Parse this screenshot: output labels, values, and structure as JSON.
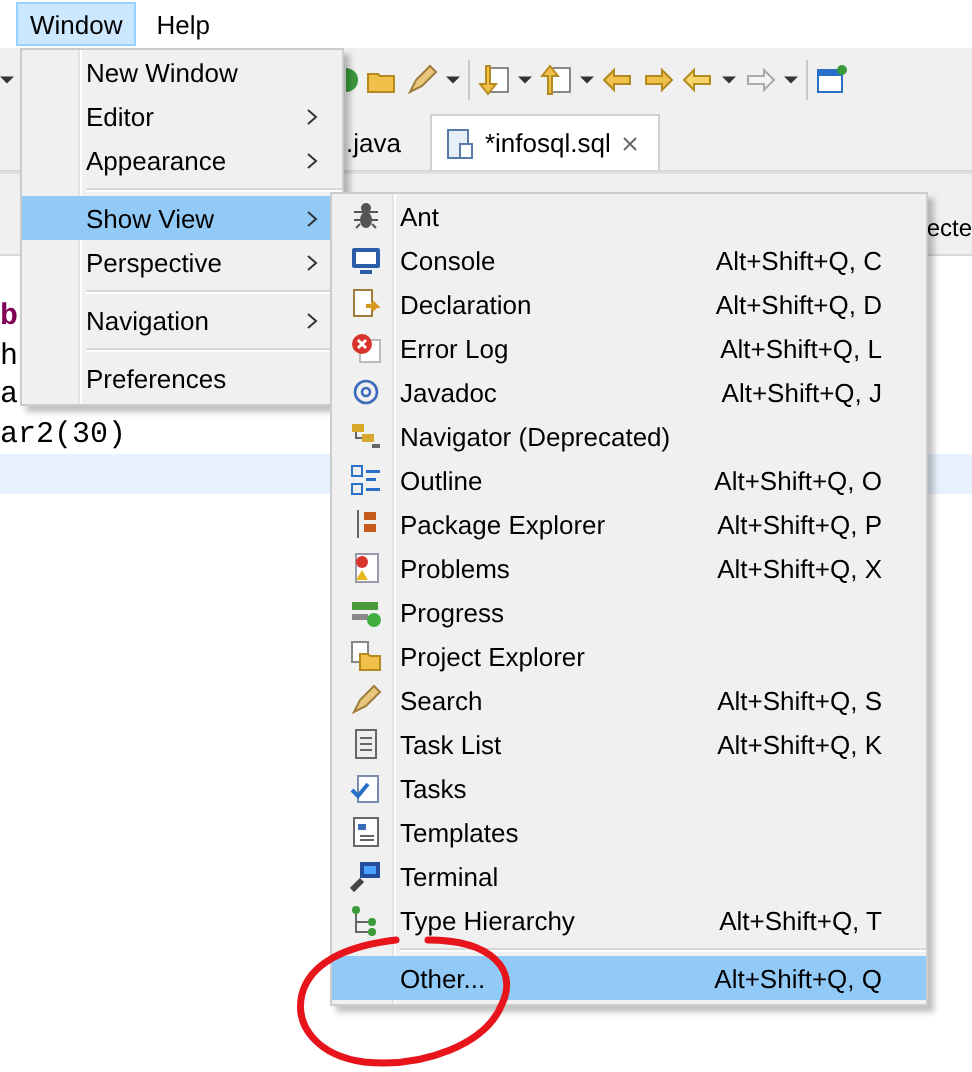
{
  "menubar": [
    {
      "label": "Window",
      "selected": true
    },
    {
      "label": "Help",
      "selected": false
    }
  ],
  "tabs": [
    {
      "label": ".java",
      "selected": false
    },
    {
      "label": "*infosql.sql",
      "selected": true
    }
  ],
  "status_text": "ecte",
  "editor": {
    "lines": [
      {
        "text": "b",
        "kind": "keyword"
      },
      {
        "text": "h",
        "kind": "plain"
      },
      {
        "text": "a",
        "kind": "plain"
      },
      {
        "text": "ar2(30)",
        "kind": "plain"
      },
      {
        "current": true
      }
    ]
  },
  "window_menu": {
    "items": [
      {
        "kind": "item",
        "label": "New Window",
        "submenu": false,
        "selected": false
      },
      {
        "kind": "item",
        "label": "Editor",
        "submenu": true,
        "selected": false
      },
      {
        "kind": "item",
        "label": "Appearance",
        "submenu": true,
        "selected": false
      },
      {
        "kind": "separator"
      },
      {
        "kind": "item",
        "label": "Show View",
        "submenu": true,
        "selected": true
      },
      {
        "kind": "item",
        "label": "Perspective",
        "submenu": true,
        "selected": false
      },
      {
        "kind": "separator"
      },
      {
        "kind": "item",
        "label": "Navigation",
        "submenu": true,
        "selected": false
      },
      {
        "kind": "separator"
      },
      {
        "kind": "item",
        "label": "Preferences",
        "submenu": false,
        "selected": false
      }
    ]
  },
  "show_view_menu": {
    "items": [
      {
        "kind": "item",
        "label": "Ant",
        "selected": false
      },
      {
        "kind": "item",
        "label": "Console",
        "shortcut": "Alt+Shift+Q, C",
        "selected": false
      },
      {
        "kind": "item",
        "label": "Declaration",
        "shortcut": "Alt+Shift+Q, D",
        "selected": false
      },
      {
        "kind": "item",
        "label": "Error Log",
        "shortcut": "Alt+Shift+Q, L",
        "selected": false
      },
      {
        "kind": "item",
        "label": "Javadoc",
        "shortcut": "Alt+Shift+Q, J",
        "selected": false
      },
      {
        "kind": "item",
        "label": "Navigator (Deprecated)",
        "selected": false
      },
      {
        "kind": "item",
        "label": "Outline",
        "shortcut": "Alt+Shift+Q, O",
        "selected": false
      },
      {
        "kind": "item",
        "label": "Package Explorer",
        "shortcut": "Alt+Shift+Q, P",
        "selected": false
      },
      {
        "kind": "item",
        "label": "Problems",
        "shortcut": "Alt+Shift+Q, X",
        "selected": false
      },
      {
        "kind": "item",
        "label": "Progress",
        "selected": false
      },
      {
        "kind": "item",
        "label": "Project Explorer",
        "selected": false
      },
      {
        "kind": "item",
        "label": "Search",
        "shortcut": "Alt+Shift+Q, S",
        "selected": false
      },
      {
        "kind": "item",
        "label": "Task List",
        "shortcut": "Alt+Shift+Q, K",
        "selected": false
      },
      {
        "kind": "item",
        "label": "Tasks",
        "selected": false
      },
      {
        "kind": "item",
        "label": "Templates",
        "selected": false
      },
      {
        "kind": "item",
        "label": "Terminal",
        "selected": false
      },
      {
        "kind": "item",
        "label": "Type Hierarchy",
        "shortcut": "Alt+Shift+Q, T",
        "selected": false
      },
      {
        "kind": "separator"
      },
      {
        "kind": "item",
        "label": "Other...",
        "shortcut": "Alt+Shift+Q, Q",
        "selected": true
      }
    ]
  }
}
